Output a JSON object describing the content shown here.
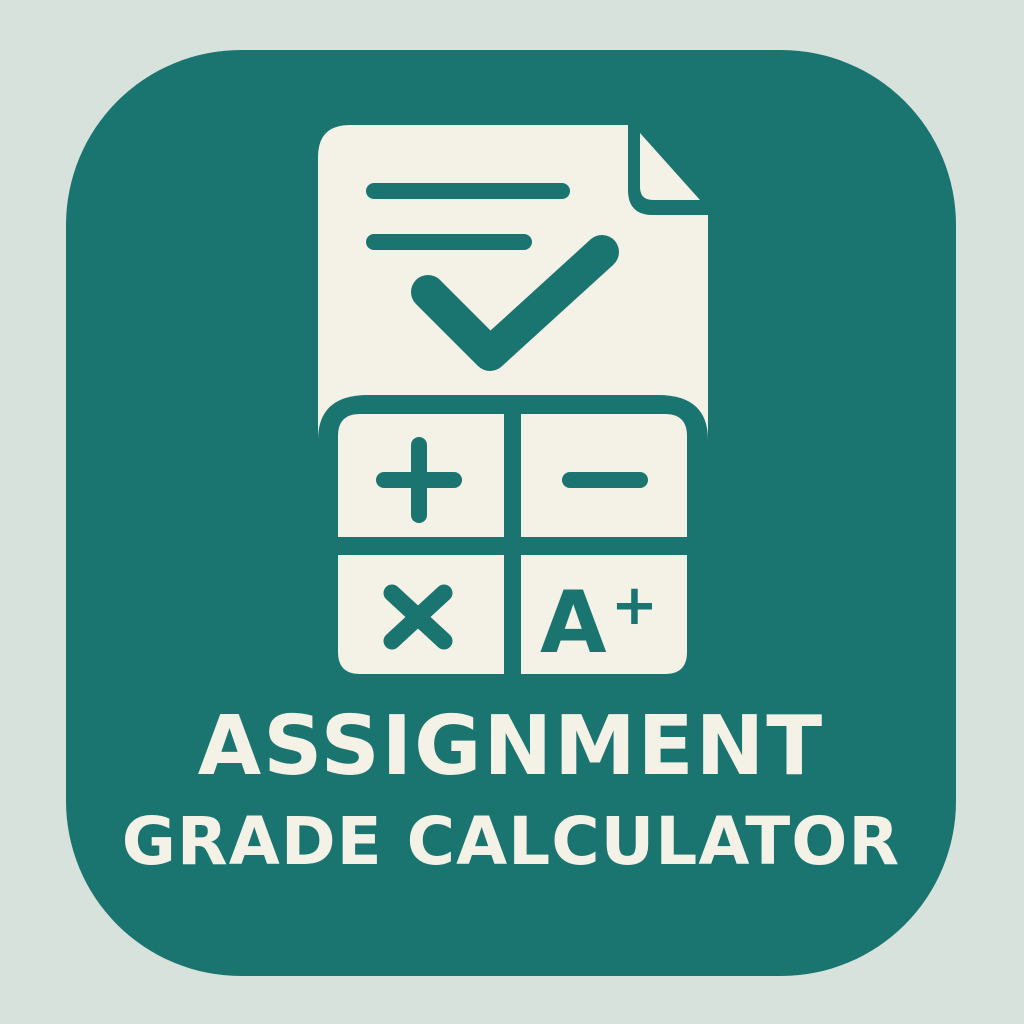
{
  "app_icon": {
    "name_line_1": "ASSIGNMENT",
    "name_line_2": "GRADE CALCULATOR",
    "keys": {
      "plus": "+",
      "minus": "−",
      "times": "×",
      "grade": "A+"
    },
    "icons": [
      "document-icon",
      "checkmark-icon",
      "calculator-icon"
    ],
    "colors": {
      "background": "#d6e2db",
      "tile": "#1a7570",
      "glyph": "#f4f1e6"
    }
  }
}
